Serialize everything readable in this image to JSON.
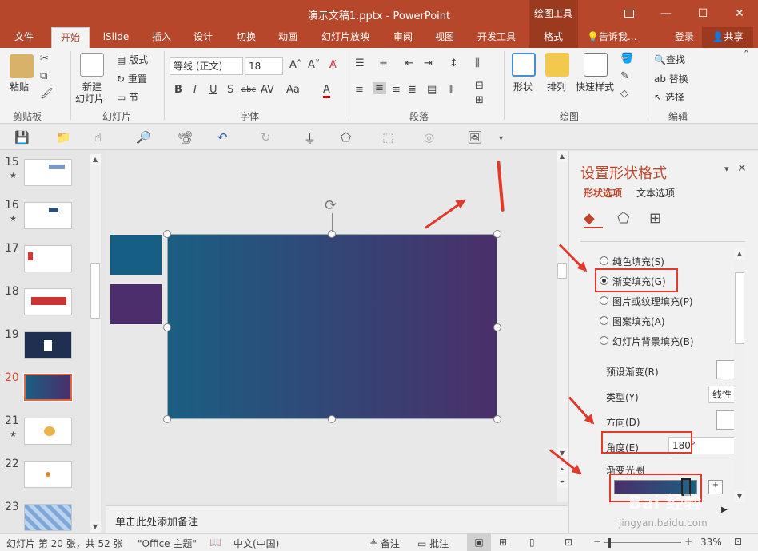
{
  "window": {
    "title": "演示文稿1.pptx - PowerPoint",
    "context_tab_group": "绘图工具",
    "restore_icon": "restore-ribbon-icon",
    "minimize": "—",
    "maximize": "☐",
    "close": "✕"
  },
  "tabs": [
    {
      "label": "文件"
    },
    {
      "label": "开始"
    },
    {
      "label": "iSlide"
    },
    {
      "label": "插入"
    },
    {
      "label": "设计"
    },
    {
      "label": "切换"
    },
    {
      "label": "动画"
    },
    {
      "label": "幻灯片放映"
    },
    {
      "label": "审阅"
    },
    {
      "label": "视图"
    },
    {
      "label": "开发工具"
    },
    {
      "label": "格式"
    }
  ],
  "tellme": "告诉我...",
  "login": "登录",
  "share": "共享",
  "ribbon": {
    "clipboard": {
      "paste": "粘贴",
      "label": "剪贴板"
    },
    "slides": {
      "new_slide_1": "新建",
      "new_slide_2": "幻灯片",
      "layout": "版式",
      "reset": "重置",
      "section": "节",
      "label": "幻灯片"
    },
    "font": {
      "font_name": "等线 (正文)",
      "font_size": "18",
      "bold": "B",
      "italic": "I",
      "underline": "U",
      "shadow": "S",
      "strike": "abc",
      "spacing": "AV",
      "case": "Aa",
      "label": "字体"
    },
    "paragraph": {
      "label": "段落"
    },
    "drawing": {
      "shapes": "形状",
      "arrange": "排列",
      "quick_styles": "快速样式",
      "label": "绘图"
    },
    "editing": {
      "find": "查找",
      "replace": "替换",
      "select": "选择",
      "label": "编辑"
    }
  },
  "thumbnails": [
    {
      "num": "15",
      "star": "★"
    },
    {
      "num": "16",
      "star": "★"
    },
    {
      "num": "17",
      "star": ""
    },
    {
      "num": "18",
      "star": ""
    },
    {
      "num": "19",
      "star": ""
    },
    {
      "num": "20",
      "star": ""
    },
    {
      "num": "21",
      "star": "★"
    },
    {
      "num": "22",
      "star": ""
    },
    {
      "num": "23",
      "star": ""
    }
  ],
  "slide": {
    "gradient_start": "#1b5e82",
    "gradient_end": "#4a2f6a",
    "swatch_1": "#175e84",
    "swatch_2": "#4b2e6b"
  },
  "notes_placeholder": "单击此处添加备注",
  "pane": {
    "title": "设置形状格式",
    "tab_shape": "形状选项",
    "tab_text": "文本选项",
    "fill_options": [
      {
        "label": "纯色填充(S)",
        "selected": false
      },
      {
        "label": "渐变填充(G)",
        "selected": true
      },
      {
        "label": "图片或纹理填充(P)",
        "selected": false
      },
      {
        "label": "图案填充(A)",
        "selected": false
      },
      {
        "label": "幻灯片背景填充(B)",
        "selected": false
      }
    ],
    "preset_gradient": "预设渐变(R)",
    "type_label": "类型(Y)",
    "type_value": "线性",
    "direction": "方向(D)",
    "angle_label": "角度(E)",
    "angle_value": "180°",
    "stops_label": "渐变光圈"
  },
  "status": {
    "slide_info": "幻灯片 第 20 张，共 52 张",
    "theme": "\"Office 主题\"",
    "language": "中文(中国)",
    "notes": "备注",
    "comments": "批注",
    "zoom": "33%"
  },
  "watermark": {
    "text": "Bai 经验",
    "url": "jingyan.baidu.com"
  }
}
